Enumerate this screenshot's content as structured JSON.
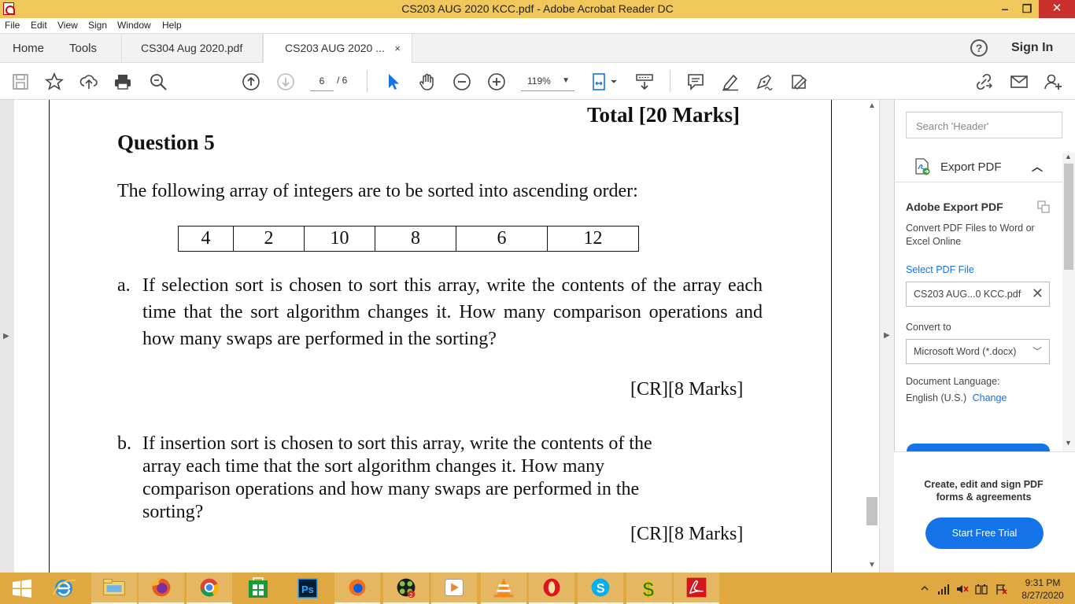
{
  "window": {
    "title": "CS203 AUG 2020 KCC.pdf - Adobe Acrobat Reader DC",
    "minimize": "‒",
    "restore": "❐",
    "close": "✕"
  },
  "menu": [
    "File",
    "Edit",
    "View",
    "Sign",
    "Window",
    "Help"
  ],
  "tabs": {
    "home": "Home",
    "tools": "Tools",
    "doc1": "CS304 Aug 2020.pdf",
    "doc2": "CS203 AUG 2020 ...",
    "doc2_close": "×",
    "help": "?",
    "sign_in": "Sign In"
  },
  "toolbar": {
    "page_current": "6",
    "page_total": "/ 6",
    "zoom": "119%",
    "icons": [
      "save-icon",
      "star-icon",
      "upload-icon",
      "print-icon",
      "find-icon",
      "prev-page-icon",
      "next-page-icon",
      "select-icon",
      "hand-icon",
      "zoom-out-icon",
      "zoom-in-icon",
      "fit-icon",
      "scroll-mode-icon",
      "comment-icon",
      "highlight-icon",
      "sign-icon",
      "fill-sign-icon",
      "link-icon",
      "mail-icon",
      "add-user-icon"
    ]
  },
  "document": {
    "total_marks": "Total [20 Marks]",
    "question_title": "Question 5",
    "intro": "The following array of integers are to be sorted into ascending order:",
    "array": [
      "4",
      "2",
      "10",
      "8",
      "6",
      "12"
    ],
    "part_a_label": "a.",
    "part_a_text": "If selection sort is chosen to sort this array, write the contents of the array each time that the sort algorithm changes it. How many comparison operations and how many swaps are performed in the sorting?",
    "part_a_marks": "[CR][8 Marks]",
    "part_b_label": "b.",
    "part_b_text": "If insertion sort is chosen to sort this array, write the contents of the array each time that the sort algorithm changes it. How many comparison operations and how many swaps are performed in the sorting?",
    "part_b_marks": "[CR][8 Marks]"
  },
  "right_panel": {
    "search_placeholder": "Search 'Header'",
    "export_label": "Export PDF",
    "title": "Adobe Export PDF",
    "description": "Convert PDF Files to Word or Excel Online",
    "select_file": "Select PDF File",
    "file_name": "CS203 AUG...0 KCC.pdf",
    "convert_to_label": "Convert to",
    "convert_to_value": "Microsoft Word (*.docx)",
    "language_label": "Document Language:",
    "language_value": "English (U.S.)",
    "language_change": "Change",
    "promo": "Create, edit and sign PDF forms & agreements",
    "trial_button": "Start Free Trial"
  },
  "taskbar": {
    "apps": [
      "start",
      "internet-explorer",
      "file-explorer",
      "firefox",
      "chrome",
      "store",
      "photoshop",
      "firefox-dev",
      "ccleaner",
      "media-player",
      "vlc",
      "opera",
      "skype",
      "money-app",
      "acrobat"
    ],
    "time": "9:31 PM",
    "date": "8/27/2020"
  },
  "colors": {
    "titlebar": "#f0c75a",
    "taskbar": "#e0a840",
    "accent": "#1473e6",
    "close": "#c9302c"
  }
}
